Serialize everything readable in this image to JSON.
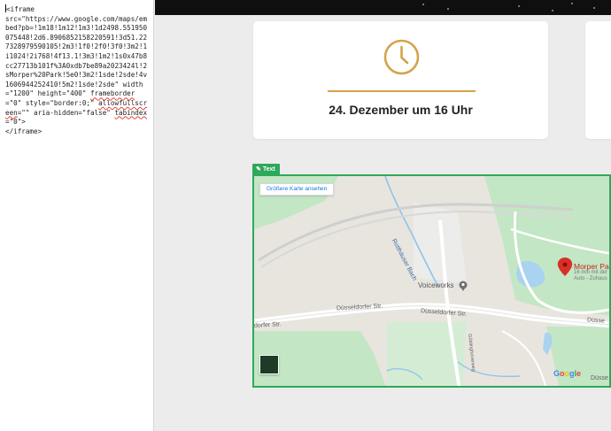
{
  "editor": {
    "line1": "<iframe",
    "code_body": "src=\"https://www.google.com/maps/embed?pb=!1m18!1m12!1m3!1d2498.551950075448!2d6.8906852158220591!3d51.227328979590105!2m3!1f0!2f0!3f0!3m2!1i1024!2i768!4f13.1!3m3!1m2!1s0x47b8cc27713b101f%3A0xdb7be89a2023424l!2sMorper%20Park!5e0!3m2!1sde!2sde!4v1606944252410!5m2!1sde!2sde\" width=\"1200\" height=\"400\" ",
    "frameborder": "frameborder",
    "frameborder_rest": "=\"0\" style=\"border:0;\" ",
    "allowfullscreen": "allowfullscreen",
    "allow_rest": "=\"\" aria-hidden=\"false\" ",
    "tabindex": "tabindex",
    "tab_rest": "=\"0\">",
    "close_tag": "</iframe>"
  },
  "card": {
    "title": "24. Dezember um 16 Uhr",
    "accent": "#d5a34a"
  },
  "widget": {
    "tag_label": "Text",
    "border_color": "#2ea85b"
  },
  "map": {
    "larger_map_button": "Größere Karte ansehen",
    "labels": {
      "stream": "Rotthäuser Bach",
      "voiceworks": "Voiceworks",
      "street_left": "dorfer Str.",
      "street_mid": "Düsseldorfer Str.",
      "street_right": "Düsseldorfer Str.",
      "street_far": "Düsse",
      "street_bottom_right": "Düsse",
      "side_street": "Göblinghoverweg"
    },
    "poi": {
      "name": "Morper Par",
      "sub_line1": "16 min mit der",
      "sub_line2": "Auto - Zuhaus"
    },
    "google_letters": [
      "G",
      "o",
      "o",
      "g",
      "l",
      "e"
    ]
  }
}
